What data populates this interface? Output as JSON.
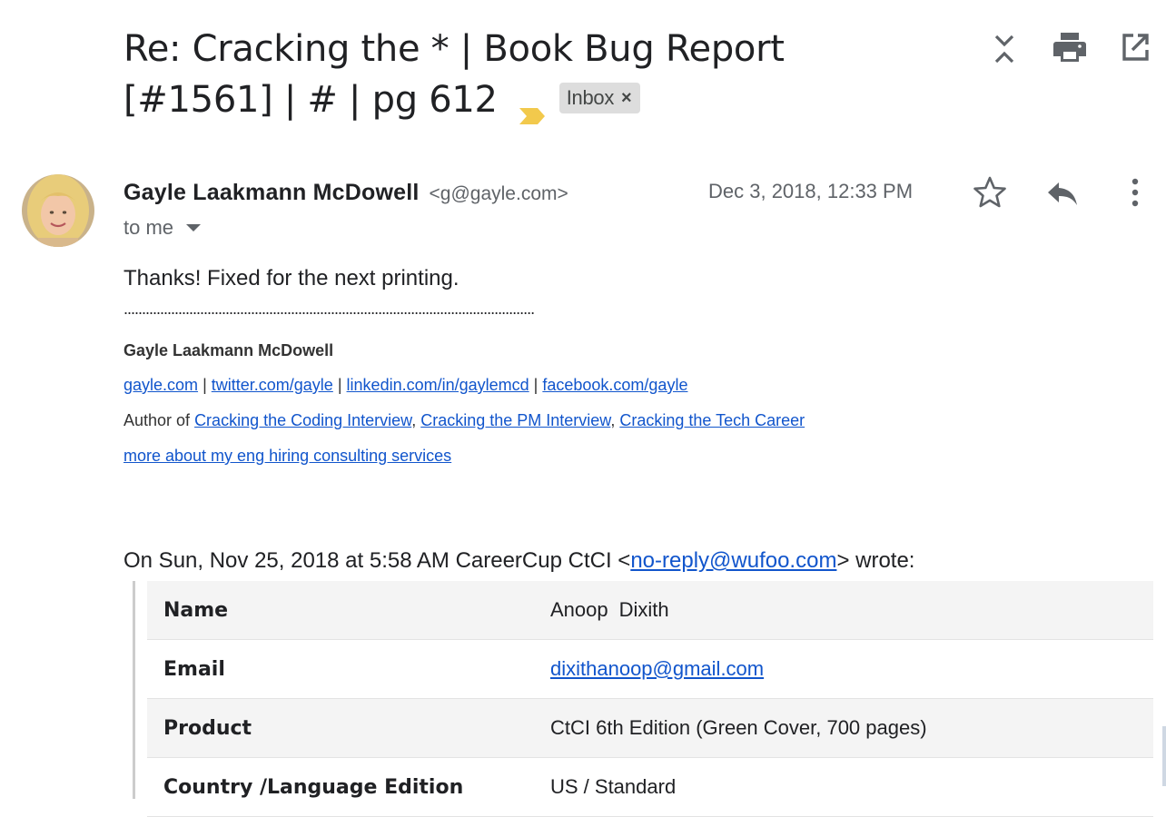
{
  "thread": {
    "subject": "Re: Cracking the * | Book Bug Report [#1561] | # | pg 612",
    "label": "Inbox",
    "label_remove_glyph": "×",
    "marker_color": "#f2c94c",
    "icons": {
      "collapse": "unfold-less-icon",
      "print": "print-icon",
      "open_new_window": "open-in-new-icon"
    }
  },
  "message": {
    "sender_name": "Gayle Laakmann McDowell",
    "sender_email": "<g@gayle.com>",
    "recipient": "to me",
    "date": "Dec 3, 2018, 12:33 PM",
    "icons": {
      "star": "star-outline-icon",
      "reply": "reply-icon",
      "more": "more-vert-icon"
    },
    "body": "Thanks! Fixed for the next printing.",
    "signature": {
      "dots": ".................................................................................................................",
      "name": "Gayle Laakmann McDowell",
      "links": [
        "gayle.com",
        "twitter.com/gayle",
        "linkedin.com/in/gaylemcd",
        "facebook.com/gayle"
      ],
      "separator": "|",
      "author_prefix": "Author of",
      "books": [
        "Cracking the Coding Interview",
        "Cracking the PM Interview",
        "Cracking the Tech Career"
      ],
      "book_separator": ",",
      "consulting_link": "more about my eng hiring consulting services"
    }
  },
  "quote": {
    "intro_prefix": "On Sun, Nov 25, 2018 at 5:58 AM CareerCup CtCI <",
    "intro_email": "no-reply@wufoo.com",
    "intro_suffix": "> wrote:",
    "rows": [
      {
        "label": "Name",
        "value_first": "Anoop",
        "value_last": "Dixith"
      },
      {
        "label": "Email",
        "value": "dixithanoop@gmail.com"
      },
      {
        "label": "Product",
        "value": "CtCI 6th Edition (Green Cover, 700 pages)"
      },
      {
        "label": "Country /Language Edition",
        "value": "US / Standard"
      }
    ]
  },
  "colors": {
    "link": "#1155cc",
    "icon_gray": "#5f6368",
    "row_shade": "#f4f4f4"
  }
}
